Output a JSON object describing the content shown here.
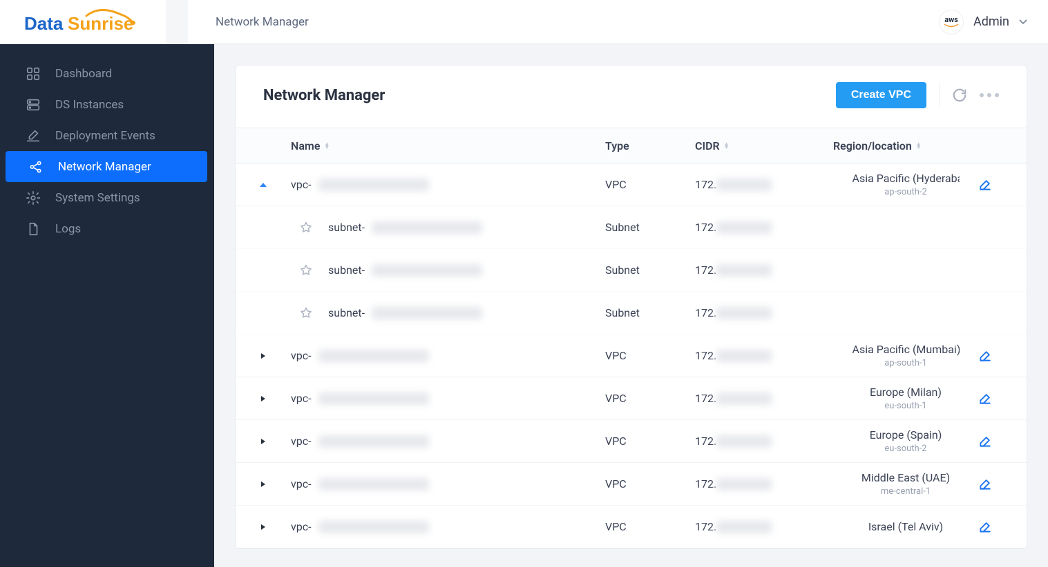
{
  "header": {
    "page_title": "Network Manager",
    "user_name": "Admin",
    "cloud_badge": "aws"
  },
  "sidebar": {
    "items": [
      {
        "label": "Dashboard",
        "icon": "grid-icon"
      },
      {
        "label": "DS Instances",
        "icon": "server-icon"
      },
      {
        "label": "Deployment Events",
        "icon": "pencil-line-icon"
      },
      {
        "label": "Network Manager",
        "icon": "share-icon",
        "active": true
      },
      {
        "label": "System Settings",
        "icon": "gear-icon"
      },
      {
        "label": "Logs",
        "icon": "file-icon"
      }
    ]
  },
  "panel": {
    "title": "Network Manager",
    "create_button": "Create VPC"
  },
  "table": {
    "columns": {
      "name": "Name",
      "type": "Type",
      "cidr": "CIDR",
      "region": "Region/location"
    },
    "rows": [
      {
        "expanded": true,
        "name_prefix": "vpc-",
        "type": "VPC",
        "cidr_prefix": "172.",
        "region_name": "Asia Pacific (Hyderabad)",
        "region_code": "ap-south-2",
        "editable": true,
        "subnets": [
          {
            "name_prefix": "subnet-",
            "type": "Subnet",
            "cidr_prefix": "172."
          },
          {
            "name_prefix": "subnet-",
            "type": "Subnet",
            "cidr_prefix": "172."
          },
          {
            "name_prefix": "subnet-",
            "type": "Subnet",
            "cidr_prefix": "172."
          }
        ]
      },
      {
        "expanded": false,
        "name_prefix": "vpc-",
        "type": "VPC",
        "cidr_prefix": "172.",
        "region_name": "Asia Pacific (Mumbai)",
        "region_code": "ap-south-1",
        "editable": true
      },
      {
        "expanded": false,
        "name_prefix": "vpc-",
        "type": "VPC",
        "cidr_prefix": "172.",
        "region_name": "Europe (Milan)",
        "region_code": "eu-south-1",
        "editable": true
      },
      {
        "expanded": false,
        "name_prefix": "vpc-",
        "type": "VPC",
        "cidr_prefix": "172.",
        "region_name": "Europe (Spain)",
        "region_code": "eu-south-2",
        "editable": true
      },
      {
        "expanded": false,
        "name_prefix": "vpc-",
        "type": "VPC",
        "cidr_prefix": "172.",
        "region_name": "Middle East (UAE)",
        "region_code": "me-central-1",
        "editable": true
      },
      {
        "expanded": false,
        "name_prefix": "vpc-",
        "type": "VPC",
        "cidr_prefix": "172.",
        "region_name": "Israel (Tel Aviv)",
        "region_code": "",
        "editable": true
      }
    ]
  }
}
